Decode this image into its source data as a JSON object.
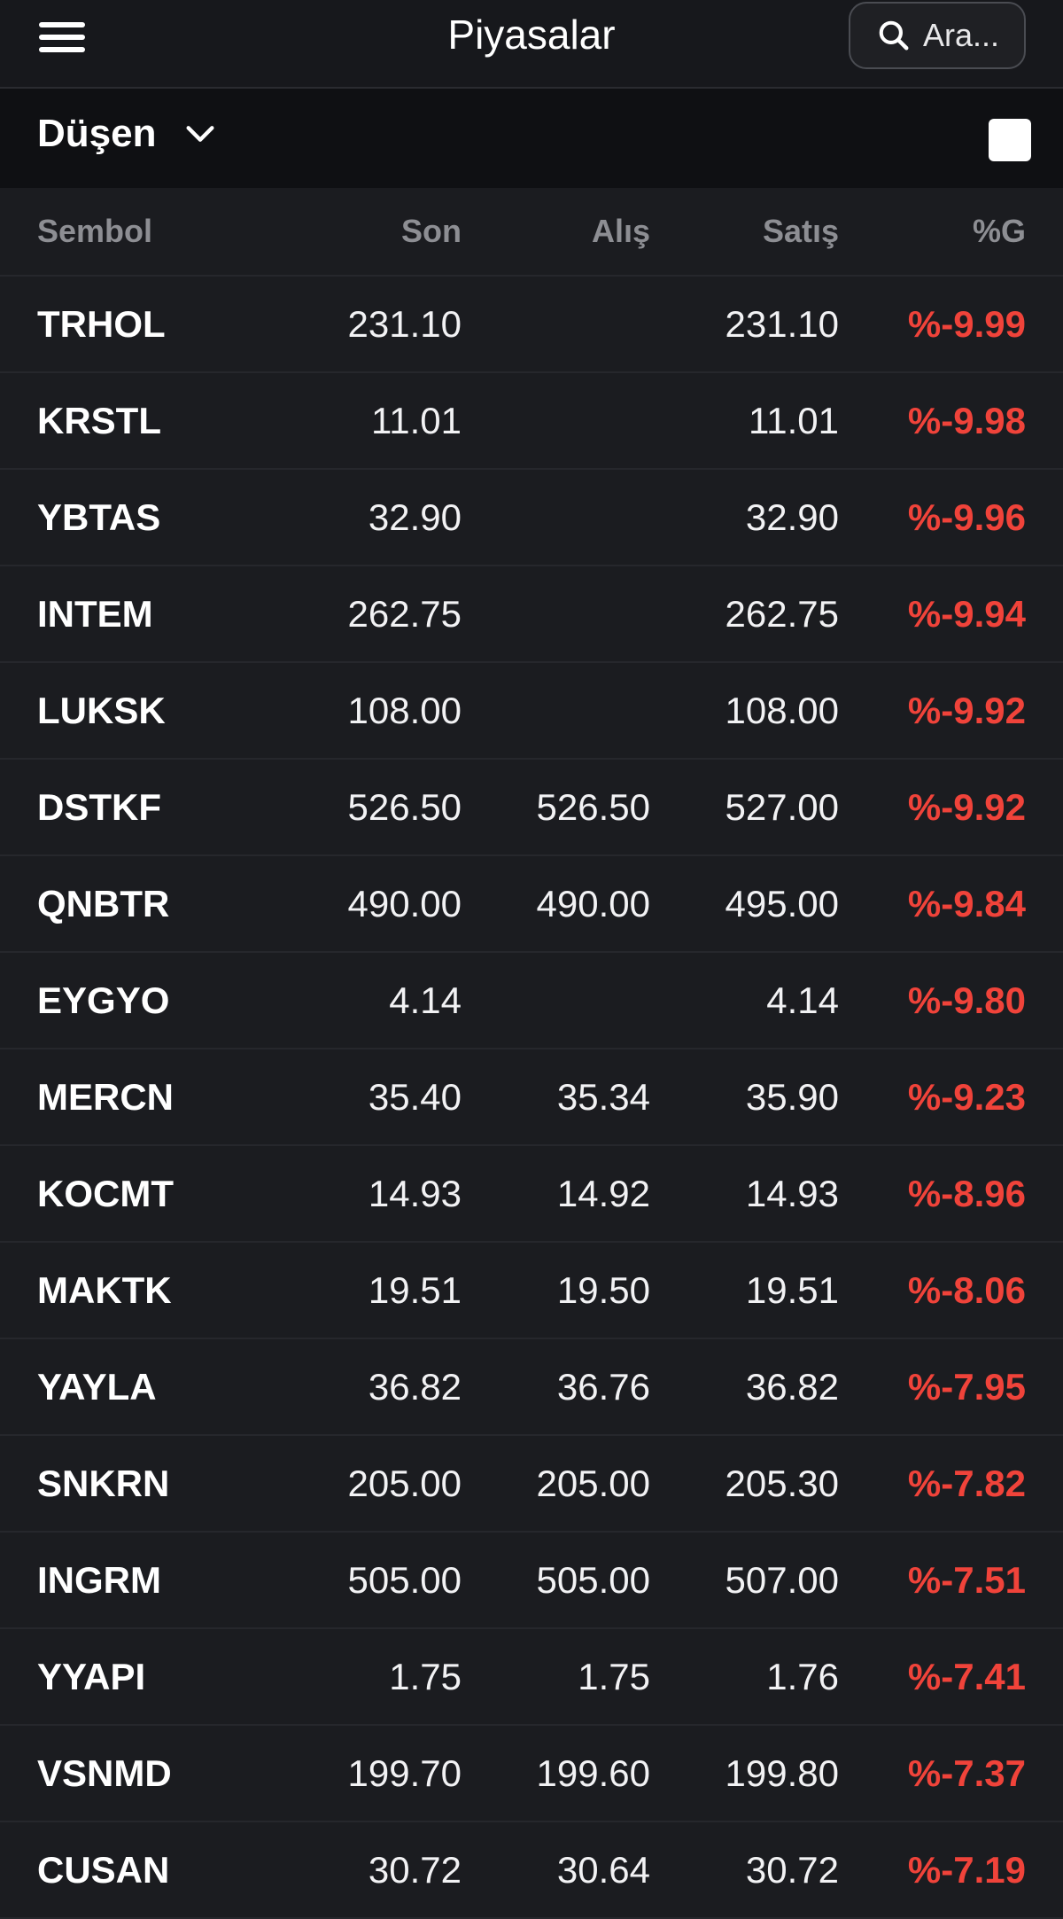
{
  "header": {
    "title": "Piyasalar",
    "search_label": "Ara...",
    "menu_icon": "hamburger-menu-icon",
    "search_icon": "search-icon"
  },
  "filter": {
    "selected": "Düşen",
    "dropdown_icon": "chevron-down-icon"
  },
  "table": {
    "columns": [
      "Sembol",
      "Son",
      "Alış",
      "Satış",
      "%G"
    ],
    "rows": [
      {
        "symbol": "TRHOL",
        "son": "231.10",
        "alis": "",
        "satis": "231.10",
        "g": "%-9.99"
      },
      {
        "symbol": "KRSTL",
        "son": "11.01",
        "alis": "",
        "satis": "11.01",
        "g": "%-9.98"
      },
      {
        "symbol": "YBTAS",
        "son": "32.90",
        "alis": "",
        "satis": "32.90",
        "g": "%-9.96"
      },
      {
        "symbol": "INTEM",
        "son": "262.75",
        "alis": "",
        "satis": "262.75",
        "g": "%-9.94"
      },
      {
        "symbol": "LUKSK",
        "son": "108.00",
        "alis": "",
        "satis": "108.00",
        "g": "%-9.92"
      },
      {
        "symbol": "DSTKF",
        "son": "526.50",
        "alis": "526.50",
        "satis": "527.00",
        "g": "%-9.92"
      },
      {
        "symbol": "QNBTR",
        "son": "490.00",
        "alis": "490.00",
        "satis": "495.00",
        "g": "%-9.84"
      },
      {
        "symbol": "EYGYO",
        "son": "4.14",
        "alis": "",
        "satis": "4.14",
        "g": "%-9.80"
      },
      {
        "symbol": "MERCN",
        "son": "35.40",
        "alis": "35.34",
        "satis": "35.90",
        "g": "%-9.23"
      },
      {
        "symbol": "KOCMT",
        "son": "14.93",
        "alis": "14.92",
        "satis": "14.93",
        "g": "%-8.96"
      },
      {
        "symbol": "MAKTK",
        "son": "19.51",
        "alis": "19.50",
        "satis": "19.51",
        "g": "%-8.06"
      },
      {
        "symbol": "YAYLA",
        "son": "36.82",
        "alis": "36.76",
        "satis": "36.82",
        "g": "%-7.95"
      },
      {
        "symbol": "SNKRN",
        "son": "205.00",
        "alis": "205.00",
        "satis": "205.30",
        "g": "%-7.82"
      },
      {
        "symbol": "INGRM",
        "son": "505.00",
        "alis": "505.00",
        "satis": "507.00",
        "g": "%-7.51"
      },
      {
        "symbol": "YYAPI",
        "son": "1.75",
        "alis": "1.75",
        "satis": "1.76",
        "g": "%-7.41"
      },
      {
        "symbol": "VSNMD",
        "son": "199.70",
        "alis": "199.60",
        "satis": "199.80",
        "g": "%-7.37"
      },
      {
        "symbol": "CUSAN",
        "son": "30.72",
        "alis": "30.64",
        "satis": "30.72",
        "g": "%-7.19"
      }
    ]
  },
  "colors": {
    "background": "#1b1c20",
    "topbar": "#17181c",
    "filterbar": "#0f1013",
    "negative": "#f0433a",
    "header_text": "#8d8e93"
  }
}
